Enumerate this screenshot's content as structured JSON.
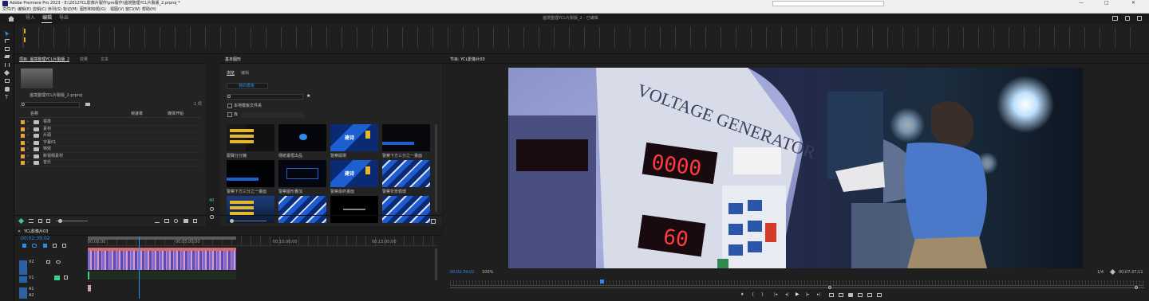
{
  "app": {
    "title_bar": "Adobe Premiere Pro 2023 - E:\\2012YCL影像片製作\\pre製作\\邊境整理YCL片製版_2.prproj *",
    "menu": [
      "文件(F)",
      "编辑(E)",
      "剪辑(C)",
      "序列(S)",
      "标记(M)",
      "图形和标题(G)",
      "视图(V)",
      "窗口(W)",
      "帮助(H)"
    ],
    "workspace_tabs": [
      "导入",
      "编辑",
      "导出"
    ],
    "active_workspace": "编辑",
    "doc_title": "邊境整理YCL片製版_2 - 已编辑"
  },
  "project_panel": {
    "tabs": [
      "项目: 邊境整理YCL片製版_2",
      "效果",
      "文本"
    ],
    "project_file": "邊境整理YCL片製版_2.prproj",
    "count": "1 项",
    "columns": [
      "名称",
      "帧速率",
      "媒体开始"
    ],
    "items": [
      "標準",
      "素材",
      "片頭",
      "字幕01",
      "特效",
      "新視頻素材",
      "音乐"
    ]
  },
  "essential_graphics": {
    "tab": "基本图形",
    "subtabs": [
      "浏览",
      "编辑"
    ],
    "dropdown": "我的模板",
    "search_placeholder": "",
    "checkbox1": "本地模板文件夹",
    "checkbox2": "库",
    "templates": [
      {
        "label": "跟聲分分鐘",
        "style": "list"
      },
      {
        "label": "傳統畫框出品",
        "style": "logo"
      },
      {
        "label": "警察開場",
        "style": "blue"
      },
      {
        "label": "警察下方三分之一畫面",
        "style": "dark"
      },
      {
        "label": "警察下方三分之一畫面",
        "style": "dark2"
      },
      {
        "label": "警察圖形疊加",
        "style": "darkblue"
      },
      {
        "label": "警察最終畫面",
        "style": "blue"
      },
      {
        "label": "警察背景循環",
        "style": "stripes"
      },
      {
        "label": "",
        "style": "list2"
      },
      {
        "label": "",
        "style": "stripes"
      },
      {
        "label": "",
        "style": "text"
      },
      {
        "label": "",
        "style": "stripes"
      }
    ],
    "thumb_text": "建诗"
  },
  "timeline": {
    "tab": "YCL影像片03",
    "timecode": "00;02;39;02",
    "ruler": [
      "00;00;00",
      "00;05;00;00",
      "00;10;00;00",
      "00;15;00;00"
    ],
    "tracks": [
      "V2",
      "V1",
      "A1",
      "A2"
    ]
  },
  "program_monitor": {
    "tab": "节目: YCL影像片03",
    "timecode_left": "00;02;39;02",
    "zoom": "100%",
    "resolution": "1/4",
    "timecode_right": "00;07;37;11",
    "scene_text": "VOLTAGE GENERATOR",
    "display_top": "0000",
    "display_bottom": "60"
  },
  "colors": {
    "accent_blue": "#2d8ceb",
    "clip_pink": "#d89ac6",
    "clip_purple": "#7d6bd4",
    "audio_green": "#3ccf8e"
  }
}
